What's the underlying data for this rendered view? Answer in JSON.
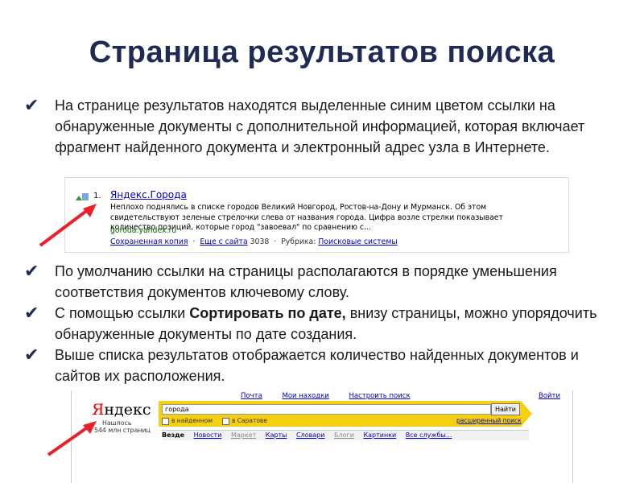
{
  "slide": {
    "title": "Страница результатов поиска",
    "bullets": [
      {
        "text": "На странице результатов находятся выделенные синим цветом ссылки на обнаруженные документы с дополнительной информацией, которая включает фрагмент найденного документа и электронный адрес узла в Интернете."
      },
      {
        "text": "По умолчанию ссылки на страницы располагаются в порядке уменьшения соответствия документов ключевому слову."
      },
      {
        "pre": "С помощью ссылки ",
        "bold": "Сортировать по дате,",
        "post": " внизу страницы, можно упорядочить обнаруженные документы по дате создания."
      },
      {
        "text": "Выше списка результатов отображается количество найденных документов и сайтов их расположения."
      }
    ]
  },
  "result": {
    "number": "1.",
    "title": "Яндекс.Города",
    "snippet_lines": [
      "Неплохо поднялись в списке городов Великий Новгород, Ростов-на-Дону и Мурманск. Об этом",
      "свидетельствуют зеленые стрелочки слева от названия города. Цифра возле стрелки показывает",
      "количество позиций, которые город \"завоевал\" по сравнению с..."
    ],
    "url": "goroda.yandex.ru",
    "cached_link": "Сохраненная копия",
    "more_link": "Еще с сайта",
    "more_count": "3038",
    "rubric_label": "Рубрика:",
    "rubric_link": "Поисковые системы",
    "separator": "·"
  },
  "yandex": {
    "logo_first": "Я",
    "logo_rest": "ндекс",
    "found_line1": "Нашлось",
    "found_line2": "544 млн страниц",
    "top_links": [
      "Почта",
      "Мои находки",
      "Настроить поиск"
    ],
    "exit_link": "Войти",
    "query": "города",
    "search_button": "Найти",
    "option1": "в найденном",
    "option2": "в Саратове",
    "advanced": "расширенный поиск",
    "tabs": [
      {
        "label": "Везде",
        "state": "active"
      },
      {
        "label": "Новости",
        "state": "link"
      },
      {
        "label": "Маркет",
        "state": "muted"
      },
      {
        "label": "Карты",
        "state": "link"
      },
      {
        "label": "Словари",
        "state": "link"
      },
      {
        "label": "Блоги",
        "state": "muted"
      },
      {
        "label": "Картинки",
        "state": "link"
      },
      {
        "label": "Все службы...",
        "state": "link"
      }
    ]
  },
  "colors": {
    "title": "#1f2a55",
    "link": "#0000cc",
    "url": "#006600",
    "arrow": "#e8212b",
    "search_bar": "#f5cf10"
  }
}
